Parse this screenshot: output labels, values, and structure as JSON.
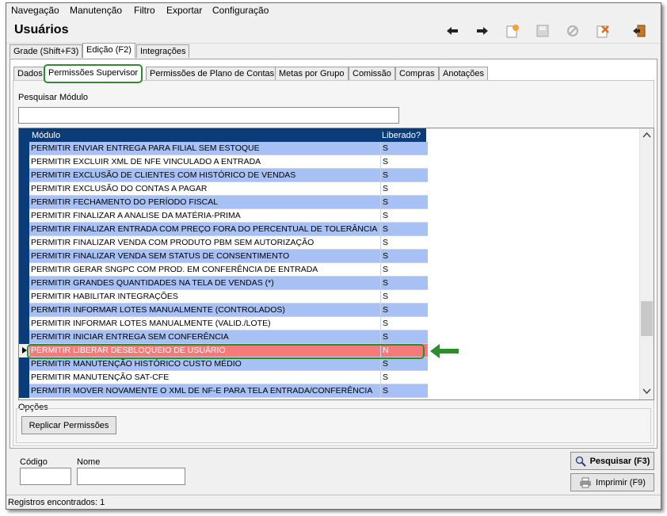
{
  "menu": [
    "Navegação",
    "Manutenção",
    "Filtro",
    "Exportar",
    "Configuração"
  ],
  "title": "Usuários",
  "toolbar_icons": [
    "arrow-left-icon",
    "arrow-right-icon",
    "new-record-icon",
    "save-icon",
    "cancel-icon",
    "delete-icon",
    "exit-icon"
  ],
  "main_tabs": [
    "Grade (Shift+F3)",
    "Edição (F2)",
    "Integrações"
  ],
  "sub_tabs": [
    "Dados",
    "Permissões Supervisor",
    "Permissões de Plano de Contas",
    "Metas por Grupo",
    "Comissão",
    "Compras",
    "Anotações"
  ],
  "search": {
    "label": "Pesquisar Módulo",
    "value": ""
  },
  "grid": {
    "headers": [
      "Módulo",
      "Liberado?"
    ],
    "rows": [
      [
        "PERMITIR ENVIAR ENTREGA PARA FILIAL SEM ESTOQUE",
        "S"
      ],
      [
        "PERMITIR EXCLUIR XML DE NFE VINCULADO A ENTRADA",
        "S"
      ],
      [
        "PERMITIR EXCLUSÃO DE CLIENTES COM HISTÓRICO DE VENDAS",
        "S"
      ],
      [
        "PERMITIR EXCLUSÃO DO CONTAS A PAGAR",
        "S"
      ],
      [
        "PERMITIR FECHAMENTO DO PERÍODO FISCAL",
        "S"
      ],
      [
        "PERMITIR FINALIZAR A ANALISE DA MATÉRIA-PRIMA",
        "S"
      ],
      [
        "PERMITIR FINALIZAR ENTRADA COM PREÇO FORA DO PERCENTUAL DE TOLERÂNCIA",
        "S"
      ],
      [
        "PERMITIR FINALIZAR VENDA COM PRODUTO PBM SEM AUTORIZAÇÃO",
        "S"
      ],
      [
        "PERMITIR FINALIZAR VENDA SEM STATUS DE CONSENTIMENTO",
        "S"
      ],
      [
        "PERMITIR GERAR SNGPC COM PROD. EM CONFERÊNCIA DE ENTRADA",
        "S"
      ],
      [
        "PERMITIR GRANDES QUANTIDADES NA TELA DE VENDAS (*)",
        "S"
      ],
      [
        "PERMITIR HABILITAR INTEGRAÇÕES",
        "S"
      ],
      [
        "PERMITIR INFORMAR LOTES MANUALMENTE (CONTROLADOS)",
        "S"
      ],
      [
        "PERMITIR INFORMAR LOTES MANUALMENTE (VALID./LOTE)",
        "S"
      ],
      [
        "PERMITIR INICIAR ENTREGA SEM CONFERÊNCIA",
        "S"
      ],
      [
        "PERMITIR LIBERAR DESBLOQUEIO DE USUÁRIO",
        "N"
      ],
      [
        "PERMITIR MANUTENÇÃO HISTÓRICO CUSTO MÉDIO",
        "S"
      ],
      [
        "PERMITIR MANUTENÇÃO SAT-CFE",
        "S"
      ],
      [
        "PERMITIR MOVER NOVAMENTE O XML DE NF-E PARA TELA ENTRADA/CONFERÊNCIA",
        "S"
      ]
    ],
    "selected_row": 15
  },
  "options": {
    "label": "Opções",
    "button": "Replicar Permissões"
  },
  "bottom": {
    "codigo_label": "Código",
    "codigo_value": "",
    "nome_label": "Nome",
    "nome_value": "",
    "search_button": "Pesquisar (F3)",
    "print_button": "Imprimir (F9)"
  },
  "status": "Registros encontrados: 1",
  "colors": {
    "header": "#0a3c7a",
    "row_alt": "#a7c1f4",
    "row_selected": "#f67a78",
    "highlight": "#2e8b2e"
  }
}
